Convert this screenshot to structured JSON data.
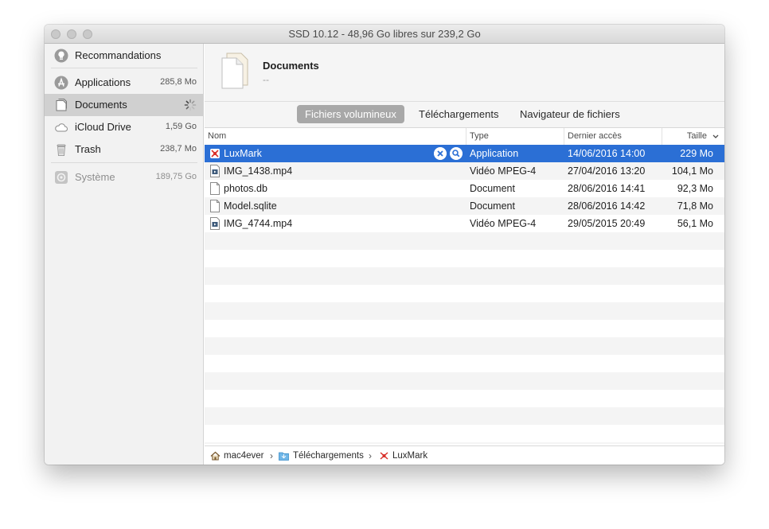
{
  "window": {
    "title": "SSD 10.12 - 48,96 Go libres sur 239,2 Go"
  },
  "sidebar": {
    "items": [
      {
        "label": "Recommandations",
        "size": "",
        "icon": "lightbulb-icon"
      },
      {
        "label": "Applications",
        "size": "285,8 Mo",
        "icon": "app-store-icon"
      },
      {
        "label": "Documents",
        "size": "",
        "icon": "document-icon",
        "selected": true,
        "status": "spinner"
      },
      {
        "label": "iCloud Drive",
        "size": "1,59 Go",
        "icon": "cloud-icon"
      },
      {
        "label": "Trash",
        "size": "238,7 Mo",
        "icon": "trash-icon"
      },
      {
        "label": "Système",
        "size": "189,75 Go",
        "icon": "system-icon",
        "dimmed": true
      }
    ]
  },
  "header": {
    "title": "Documents",
    "subtitle": "--"
  },
  "tabs": [
    {
      "label": "Fichiers volumineux",
      "active": true
    },
    {
      "label": "Téléchargements",
      "active": false
    },
    {
      "label": "Navigateur de fichiers",
      "active": false
    }
  ],
  "table": {
    "columns": {
      "name": "Nom",
      "type": "Type",
      "last_access": "Dernier accès",
      "size": "Taille"
    },
    "sort": {
      "column": "Taille",
      "direction": "descending"
    },
    "rows": [
      {
        "name": "LuxMark",
        "type": "Application",
        "last_access": "14/06/2016 14:00",
        "size": "229 Mo",
        "icon": "app-icon",
        "selected": true
      },
      {
        "name": "IMG_1438.mp4",
        "type": "Vidéo MPEG-4",
        "last_access": "27/04/2016 13:20",
        "size": "104,1 Mo",
        "icon": "video-file-icon"
      },
      {
        "name": "photos.db",
        "type": "Document",
        "last_access": "28/06/2016 14:41",
        "size": "92,3 Mo",
        "icon": "file-icon"
      },
      {
        "name": "Model.sqlite",
        "type": "Document",
        "last_access": "28/06/2016 14:42",
        "size": "71,8 Mo",
        "icon": "file-icon"
      },
      {
        "name": "IMG_4744.mp4",
        "type": "Vidéo MPEG-4",
        "last_access": "29/05/2015 20:49",
        "size": "56,1 Mo",
        "icon": "video-file-icon"
      }
    ]
  },
  "pathbar": {
    "crumbs": [
      {
        "label": "mac4ever",
        "icon": "home-icon"
      },
      {
        "label": "Téléchargements",
        "icon": "folder-icon"
      },
      {
        "label": "LuxMark",
        "icon": "app-icon"
      }
    ]
  },
  "colors": {
    "selection": "#2b6fd5",
    "active_tab": "#a8a8a8"
  }
}
